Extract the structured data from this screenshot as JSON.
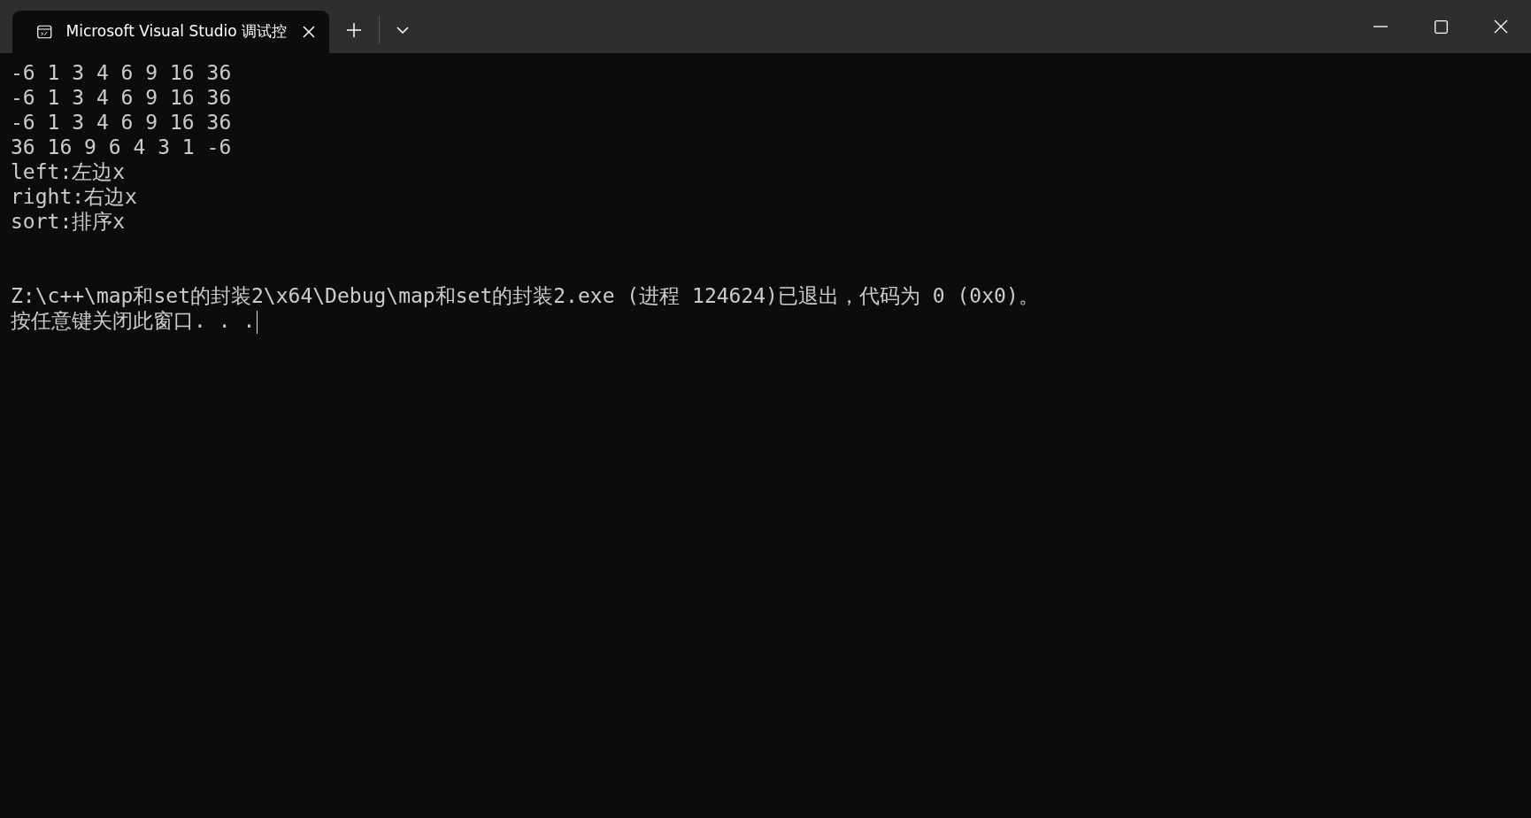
{
  "window": {
    "tab_title": "Microsoft Visual Studio 调试控"
  },
  "console": {
    "output": [
      "-6 1 3 4 6 9 16 36",
      "-6 1 3 4 6 9 16 36",
      "-6 1 3 4 6 9 16 36",
      "36 16 9 6 4 3 1 -6",
      "left:左边x",
      "right:右边x",
      "sort:排序x"
    ],
    "exit_lines": [
      "Z:\\c++\\map和set的封装2\\x64\\Debug\\map和set的封装2.exe (进程 124624)已退出，代码为 0 (0x0)。",
      "按任意键关闭此窗口. . ."
    ]
  }
}
